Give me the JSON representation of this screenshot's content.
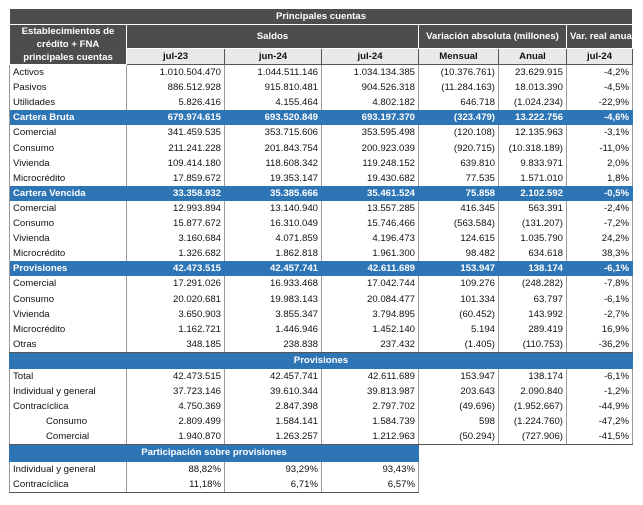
{
  "title": "Principales cuentas",
  "headers": {
    "entity_col": "Establecimientos de crédito + FNA principales cuentas",
    "saldos": "Saldos",
    "variacion": "Variación absoluta (millones)",
    "var_real": "Var. real anual",
    "sub": [
      "jul-23",
      "jun-24",
      "jul-24",
      "Mensual",
      "Anual",
      "jul-24"
    ]
  },
  "groups": [
    {
      "rows": [
        {
          "label": "Activos",
          "values": [
            "1.010.504.470",
            "1.044.511.146",
            "1.034.134.385",
            "(10.376.761)",
            "23.629.915",
            "-4,2%"
          ]
        },
        {
          "label": "Pasivos",
          "values": [
            "886.512.928",
            "915.810.481",
            "904.526.318",
            "(11.284.163)",
            "18.013.390",
            "-4,5%"
          ]
        },
        {
          "label": "Utilidades",
          "values": [
            "5.826.416",
            "4.155.464",
            "4.802.182",
            "646.718",
            "(1.024.234)",
            "-22,9%"
          ]
        }
      ]
    },
    {
      "highlight": {
        "label": "Cartera Bruta",
        "values": [
          "679.974.615",
          "693.520.849",
          "693.197.370",
          "(323.479)",
          "13.222.756",
          "-4,6%"
        ]
      },
      "rows": [
        {
          "label": "Comercial",
          "values": [
            "341.459.535",
            "353.715.606",
            "353.595.498",
            "(120.108)",
            "12.135.963",
            "-3,1%"
          ]
        },
        {
          "label": "Consumo",
          "values": [
            "211.241.228",
            "201.843.754",
            "200.923.039",
            "(920.715)",
            "(10.318.189)",
            "-11,0%"
          ]
        },
        {
          "label": "Vivienda",
          "values": [
            "109.414.180",
            "118.608.342",
            "119.248.152",
            "639.810",
            "9.833.971",
            "2,0%"
          ]
        },
        {
          "label": "Microcrédito",
          "values": [
            "17.859.672",
            "19.353.147",
            "19.430.682",
            "77.535",
            "1.571.010",
            "1,8%"
          ]
        }
      ]
    },
    {
      "highlight": {
        "label": "Cartera Vencida",
        "values": [
          "33.358.932",
          "35.385.666",
          "35.461.524",
          "75.858",
          "2.102.592",
          "-0,5%"
        ]
      },
      "rows": [
        {
          "label": "Comercial",
          "values": [
            "12.993.894",
            "13.140.940",
            "13.557.285",
            "416.345",
            "563.391",
            "-2,4%"
          ]
        },
        {
          "label": "Consumo",
          "values": [
            "15.877.672",
            "16.310.049",
            "15.746.466",
            "(563.584)",
            "(131.207)",
            "-7,2%"
          ]
        },
        {
          "label": "Vivienda",
          "values": [
            "3.160.684",
            "4.071.859",
            "4.196.473",
            "124.615",
            "1.035.790",
            "24,2%"
          ]
        },
        {
          "label": "Microcrédito",
          "values": [
            "1.326.682",
            "1.862.818",
            "1.961.300",
            "98.482",
            "634.618",
            "38,3%"
          ]
        }
      ]
    },
    {
      "highlight": {
        "label": "Provisiones",
        "values": [
          "42.473.515",
          "42.457.741",
          "42.611.689",
          "153.947",
          "138.174",
          "-6,1%"
        ]
      },
      "rows": [
        {
          "label": "Comercial",
          "values": [
            "17.291.026",
            "16.933.468",
            "17.042.744",
            "109.276",
            "(248.282)",
            "-7,8%"
          ]
        },
        {
          "label": "Consumo",
          "values": [
            "20.020.681",
            "19.983.143",
            "20.084.477",
            "101.334",
            "63.797",
            "-6,1%"
          ]
        },
        {
          "label": "Vivienda",
          "values": [
            "3.650.903",
            "3.855.347",
            "3.794.895",
            "(60.452)",
            "143.992",
            "-2,7%"
          ]
        },
        {
          "label": "Microcrédito",
          "values": [
            "1.162.721",
            "1.446.946",
            "1.452.140",
            "5.194",
            "289.419",
            "16,9%"
          ]
        },
        {
          "label": "Otras",
          "values": [
            "348.185",
            "238.838",
            "237.432",
            "(1.405)",
            "(110.753)",
            "-36,2%"
          ]
        }
      ]
    }
  ],
  "provisiones_title": "Provisiones",
  "provisiones_rows": [
    {
      "label": "Total",
      "indent": false,
      "values": [
        "42.473.515",
        "42.457.741",
        "42.611.689",
        "153.947",
        "138.174",
        "-6,1%"
      ]
    },
    {
      "label": "Individual y general",
      "indent": false,
      "values": [
        "37.723.146",
        "39.610.344",
        "39.813.987",
        "203.643",
        "2.090.840",
        "-1,2%"
      ]
    },
    {
      "label": "Contracíclica",
      "indent": false,
      "values": [
        "4.750.369",
        "2.847.398",
        "2.797.702",
        "(49.696)",
        "(1.952.667)",
        "-44,9%"
      ]
    },
    {
      "label": "Consumo",
      "indent": true,
      "values": [
        "2.809.499",
        "1.584.141",
        "1.584.739",
        "598",
        "(1.224.760)",
        "-47,2%"
      ]
    },
    {
      "label": "Comercial",
      "indent": true,
      "values": [
        "1.940.870",
        "1.263.257",
        "1.212.963",
        "(50.294)",
        "(727.906)",
        "-41,5%"
      ]
    }
  ],
  "participacion_title": "Participación sobre provisiones",
  "participacion_rows": [
    {
      "label": "Individual y general",
      "values": [
        "88,82%",
        "93,29%",
        "93,43%"
      ]
    },
    {
      "label": "Contracíclica",
      "values": [
        "11,18%",
        "6,71%",
        "6,57%"
      ]
    }
  ],
  "colors": {
    "header": "#4d4d4d",
    "highlight": "#2e75b6"
  }
}
